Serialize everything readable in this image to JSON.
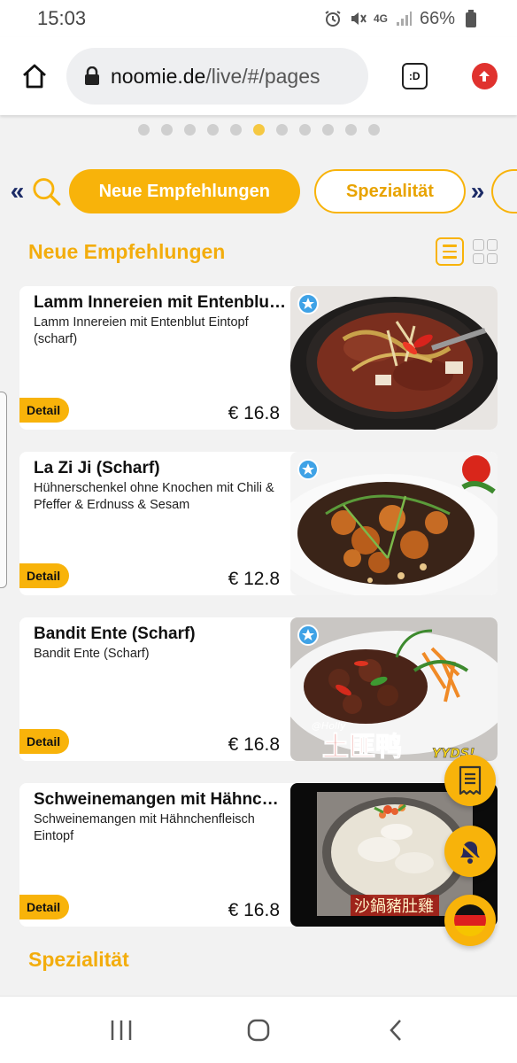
{
  "status": {
    "time": "15:03",
    "network": "4G",
    "battery": "66%",
    "icons": [
      "alarm-icon",
      "mute-icon",
      "signal-icon",
      "battery-icon"
    ]
  },
  "browser": {
    "url_domain": "noomie.de",
    "url_path": "/live/#/pages",
    "tabs_label": ":D"
  },
  "carousel": {
    "total": 11,
    "active_index": 5
  },
  "categories": {
    "active": "Neue Empfehlungen",
    "next": "Spezialität"
  },
  "section": {
    "title": "Neue Empfehlungen"
  },
  "dishes": [
    {
      "title": "Lamm Innereien mit Entenblu…",
      "desc": "Lamm Innereien mit Entenblut Eintopf (scharf)",
      "price": "€ 16.8",
      "detail": "Detail",
      "image": "lamb-offal-hotpot"
    },
    {
      "title": "La Zi Ji (Scharf)",
      "desc": "Hühnerschenkel ohne Knochen mit Chili & Pfeffer & Erdnuss & Sesam",
      "price": "€ 12.8",
      "detail": "Detail",
      "image": "chili-chicken"
    },
    {
      "title": "Bandit Ente (Scharf)",
      "desc": "Bandit Ente (Scharf)",
      "price": "€ 16.8",
      "detail": "Detail",
      "image": "bandit-duck",
      "image_caption": "土匪鸭",
      "image_tag": "@Holly",
      "image_tag2": "YYDS!"
    },
    {
      "title": "Schweinemangen mit Hähnc…",
      "desc": "Schweinemangen mit Hähnchenfleisch Eintopf",
      "price": "€ 16.8",
      "detail": "Detail",
      "image": "pork-stomach-soup",
      "image_caption": "沙鍋豬肚雞"
    }
  ],
  "section2": {
    "title": "Spezialität"
  },
  "colors": {
    "accent": "#f8b30a",
    "accent_text": "#f3ad0d",
    "badge": "#3fa2e6"
  }
}
